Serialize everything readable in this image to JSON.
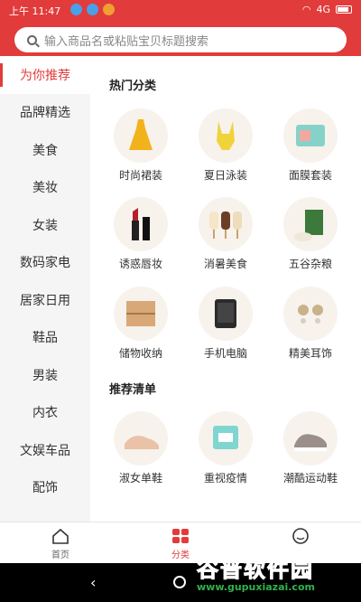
{
  "status_bar": {
    "time": "上午 11:47",
    "network": "4G"
  },
  "search": {
    "placeholder": "输入商品名或粘贴宝贝标题搜索"
  },
  "sidebar": {
    "items": [
      {
        "label": "为你推荐",
        "active": true
      },
      {
        "label": "品牌精选"
      },
      {
        "label": "美食"
      },
      {
        "label": "美妆"
      },
      {
        "label": "女装"
      },
      {
        "label": "数码家电"
      },
      {
        "label": "居家日用"
      },
      {
        "label": "鞋品"
      },
      {
        "label": "男装"
      },
      {
        "label": "内衣"
      },
      {
        "label": "文娱车品"
      },
      {
        "label": "配饰"
      }
    ]
  },
  "hot": {
    "title": "热门分类",
    "items": [
      {
        "label": "时尚裙装",
        "icon": "dress-icon"
      },
      {
        "label": "夏日泳装",
        "icon": "swimsuit-icon"
      },
      {
        "label": "面膜套装",
        "icon": "face-mask-icon"
      },
      {
        "label": "诱惑唇妆",
        "icon": "lipstick-icon"
      },
      {
        "label": "消暑美食",
        "icon": "popsicle-icon"
      },
      {
        "label": "五谷杂粮",
        "icon": "rice-bag-icon"
      },
      {
        "label": "储物收纳",
        "icon": "drawer-icon"
      },
      {
        "label": "手机电脑",
        "icon": "phone-icon"
      },
      {
        "label": "精美耳饰",
        "icon": "earring-icon"
      }
    ]
  },
  "recommend": {
    "title": "推荐清单",
    "items": [
      {
        "label": "淑女单鞋",
        "icon": "loafer-icon"
      },
      {
        "label": "重视疫情",
        "icon": "medical-mask-icon"
      },
      {
        "label": "潮酷运动鞋",
        "icon": "sneaker-icon"
      }
    ]
  },
  "bottom_nav": {
    "tabs": [
      {
        "label": "首页",
        "icon": "home-icon"
      },
      {
        "label": "分类",
        "icon": "category-icon",
        "active": true
      },
      {
        "label": "",
        "icon": "profile-icon"
      }
    ]
  },
  "watermark": {
    "brand": "谷普软件园",
    "url": "www.gupuxiazai.com"
  },
  "colors": {
    "accent": "#e23b3b",
    "watermark": "#2fb34a"
  }
}
